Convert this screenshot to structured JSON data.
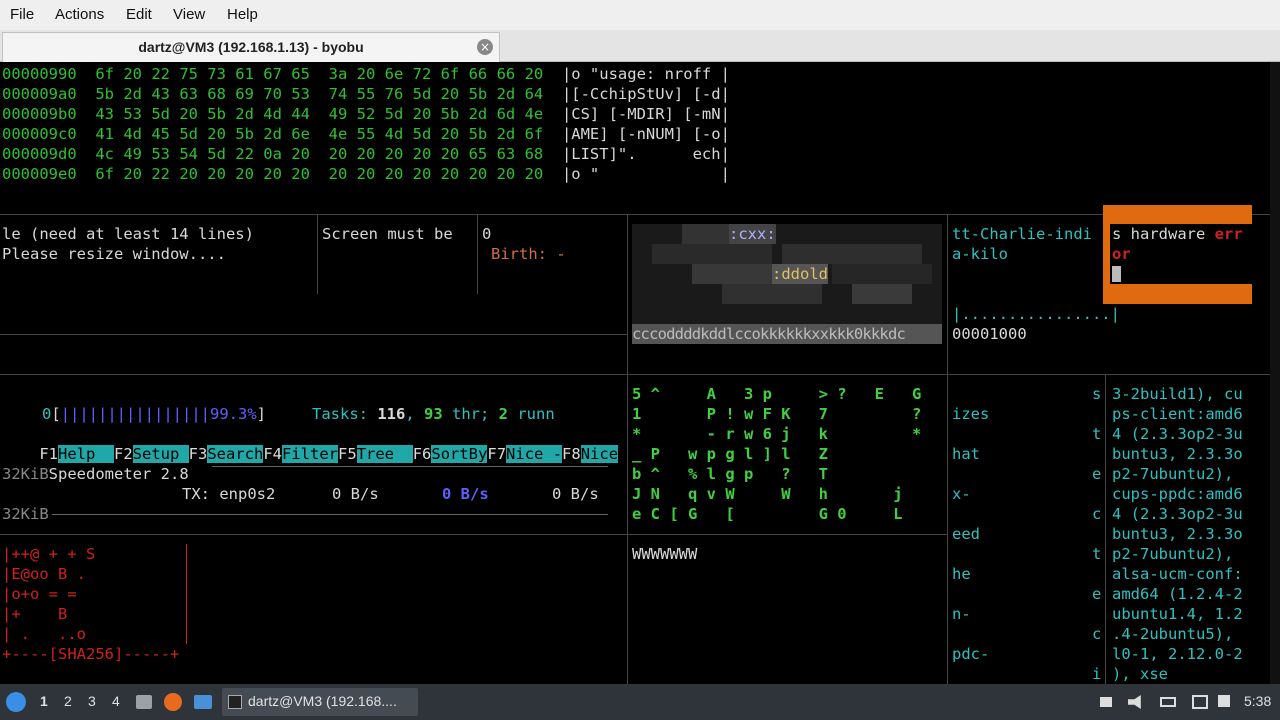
{
  "menubar": {
    "items": [
      "File",
      "Actions",
      "Edit",
      "View",
      "Help"
    ]
  },
  "tab": {
    "title": "dartz@VM3 (192.168.1.13) - byobu",
    "close": "×"
  },
  "hexdump": [
    {
      "addr": "00000990",
      "bytes": "6f 20 22 75 73 61 67 65  3a 20 6e 72 6f 66 66 20",
      "ascii": "|o \"usage: nroff |"
    },
    {
      "addr": "000009a0",
      "bytes": "5b 2d 43 63 68 69 70 53  74 55 76 5d 20 5b 2d 64",
      "ascii": "|[-CchipStUv] [-d|"
    },
    {
      "addr": "000009b0",
      "bytes": "43 53 5d 20 5b 2d 4d 44  49 52 5d 20 5b 2d 6d 4e",
      "ascii": "|CS] [-MDIR] [-mN|"
    },
    {
      "addr": "000009c0",
      "bytes": "41 4d 45 5d 20 5b 2d 6e  4e 55 4d 5d 20 5b 2d 6f",
      "ascii": "|AME] [-nNUM] [-o|"
    },
    {
      "addr": "000009d0",
      "bytes": "4c 49 53 54 5d 22 0a 20  20 20 20 20 20 65 63 68",
      "ascii": "|LIST]\".      ech|"
    },
    {
      "addr": "000009e0",
      "bytes": "6f 20 22 20 20 20 20 20  20 20 20 20 20 20 20 20",
      "ascii": "|o \"             |"
    }
  ],
  "panes": {
    "resize_line1": "le (need at least 14 lines)",
    "resize_line2": "Please resize window....",
    "screen_must": "Screen must be",
    "zero": "0",
    "birth": "Birth: -",
    "charlie1": "tt-Charlie-indi",
    "charlie2": "a-kilo",
    "hw_error1": "s hardware ",
    "hw_error_red": "err",
    "hw_error2": "or",
    "ascii_dots": "|................|",
    "offset": "00001000",
    "chart_label1": ":cxx:",
    "chart_label2": ":ddold",
    "chart_footer": "cccoddddkddlccokkkkkkxxkkk0kkkdc",
    "cpu_num": "0",
    "cpu_bar": "||||||||||||||||99.3%",
    "tasks_label": "Tasks: ",
    "tasks_count": "116",
    "tasks_sep": ", ",
    "thr_count": "93",
    "thr_label": " thr; ",
    "run_count": "2",
    "run_label": " runn",
    "speedo_prefix": "32KiB",
    "speedo": "Speedometer 2.8",
    "tx_label": "TX: enp0s2",
    "tx_rate1": "0 B/s",
    "tx_rate2": "0 B/s",
    "tx_rate3": "0 B/s",
    "speedo_prefix2": "32KiB",
    "wwww": "WWWWWWW",
    "sha_lines": [
      "|++@ + + S",
      "|E@oo B .",
      "|o+o = =",
      "|+    B",
      "| .   ..o",
      "+----[SHA256]-----+"
    ],
    "col_ghost": [
      "izes",
      "hat",
      "x-",
      "eed",
      "he",
      "n-",
      "pdc-"
    ],
    "col_letters": [
      "s",
      "t",
      "e",
      "c",
      "t",
      "e",
      "c",
      "i"
    ],
    "pkg_lines": [
      "3-2build1), cu",
      "ps-client:amd6",
      "4 (2.3.3op2-3u",
      "buntu3, 2.3.3o",
      "p2-7ubuntu2),",
      "cups-ppdc:amd6",
      "4 (2.3.3op2-3u",
      "buntu3, 2.3.3o",
      "p2-7ubuntu2),",
      "alsa-ucm-conf:",
      "amd64 (1.2.4-2",
      "ubuntu1.4, 1.2",
      ".4-2ubuntu5),",
      "l0-1, 2.12.0-2",
      "), xse"
    ]
  },
  "fkeys": [
    {
      "num": "F1",
      "label": "Help  "
    },
    {
      "num": "F2",
      "label": "Setup "
    },
    {
      "num": "F3",
      "label": "Search"
    },
    {
      "num": "F4",
      "label": "Filter"
    },
    {
      "num": "F5",
      "label": "Tree  "
    },
    {
      "num": "F6",
      "label": "SortBy"
    },
    {
      "num": "F7",
      "label": "Nice -"
    },
    {
      "num": "F8",
      "label": "Nice"
    }
  ],
  "matrix_rows": [
    "5 ^     A   3 p     > ?   E   G",
    "1       P ! w F K   7         ?",
    "*       - r w 6 j   k         *",
    "_ P   w p g l ] l   Z",
    "b ^   % l g p   ?   T",
    "J N   q v W     W   h       j",
    "e C [ G   [         G 0     L"
  ],
  "taskbar": {
    "workspaces": [
      "1",
      "2",
      "3",
      "4"
    ],
    "window_button": "dartz@VM3 (192.168....",
    "clock": "5:38"
  },
  "colors": {
    "accent_orange": "#e06a10",
    "terminal_green": "#30c030",
    "htop_cyan": "#20a8a8"
  }
}
